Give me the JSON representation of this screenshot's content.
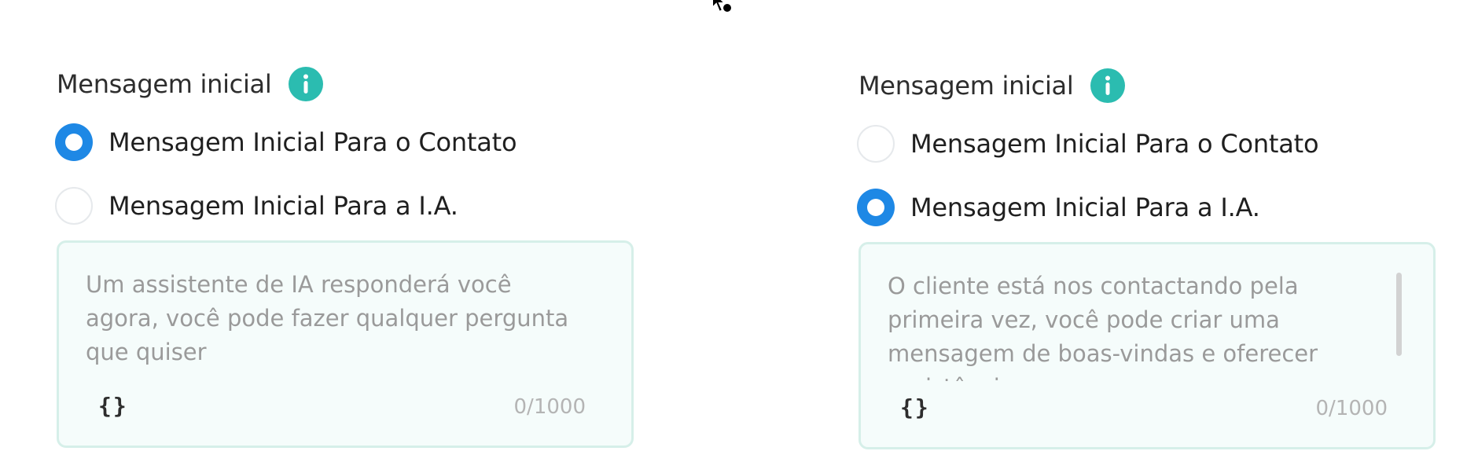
{
  "left_panel": {
    "title": "Mensagem inicial",
    "info_icon": "info-icon",
    "options": [
      {
        "label": "Mensagem Inicial Para o Contato",
        "checked": true
      },
      {
        "label": "Mensagem Inicial Para a I.A.",
        "checked": false
      }
    ],
    "textarea": {
      "placeholder": "Um assistente de IA responderá você agora, você pode fazer qualquer pergunta que quiser",
      "variable_button": "{}",
      "counter": "0/1000"
    }
  },
  "right_panel": {
    "title": "Mensagem inicial",
    "info_icon": "info-icon",
    "options": [
      {
        "label": "Mensagem Inicial Para o Contato",
        "checked": false
      },
      {
        "label": "Mensagem Inicial Para a I.A.",
        "checked": true
      }
    ],
    "textarea": {
      "placeholder": "O cliente está nos contactando pela primeira vez, você pode criar uma mensagem de boas-vindas e oferecer assistência",
      "variable_button": "{}",
      "counter": "0/1000"
    }
  },
  "colors": {
    "accent": "#1e88e5",
    "info": "#2bbcb0",
    "textbox_border": "#d6efe9",
    "textbox_bg": "#f5fcfb"
  }
}
